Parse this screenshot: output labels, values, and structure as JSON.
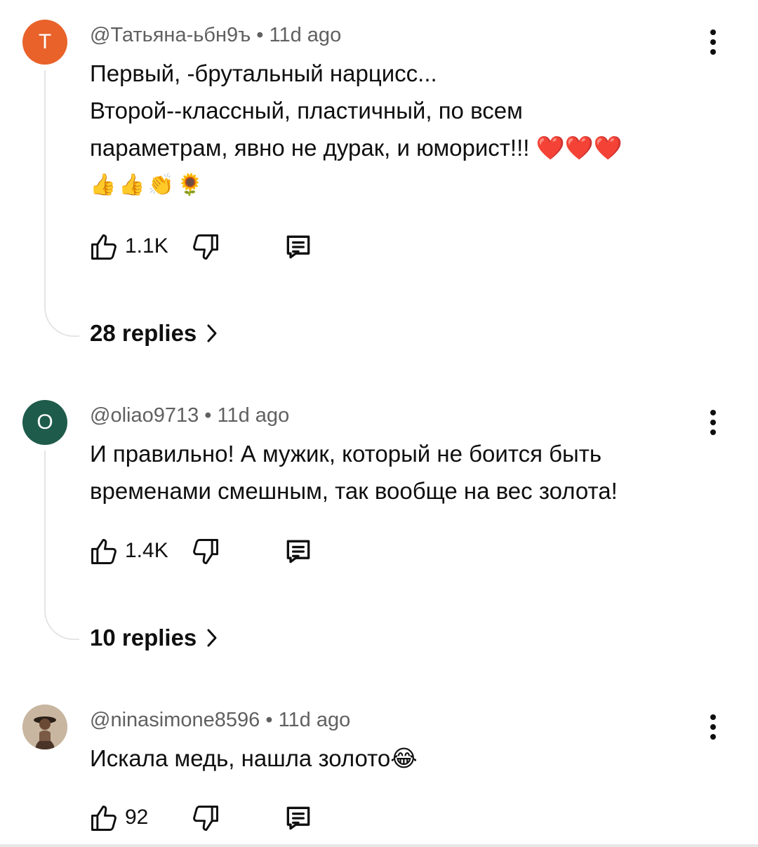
{
  "comments": [
    {
      "avatar_letter": "T",
      "avatar_color": "#e8622a",
      "author": "@Татьяна-ьбн9ъ",
      "time": "11d ago",
      "lines": [
        "Первый, -брутальный нарцисс...",
        "Второй--классный, пластичный, по всем",
        "параметрам, явно не дурак, и юморист!!! ❤️❤️❤️",
        "👍👍👏🌻"
      ],
      "likes": "1.1K",
      "replies": "28 replies"
    },
    {
      "avatar_letter": "O",
      "avatar_color": "#1e5b4b",
      "author": "@oliao9713",
      "time": "11d ago",
      "lines": [
        "И правильно! А мужик, который не боится быть",
        "временами смешным, так вообще на вес золота!"
      ],
      "likes": "1.4K",
      "replies": "10 replies"
    },
    {
      "avatar_letter": "",
      "avatar_color": "#b9a48e",
      "author": "@ninasimone8596",
      "time": "11d ago",
      "lines": [
        "Искала медь, нашла золото😂"
      ],
      "likes": "92"
    }
  ],
  "separator": "•",
  "icons": {
    "like": "thumb-up-icon",
    "dislike": "thumb-down-icon",
    "reply": "comment-icon",
    "more": "more-vert-icon",
    "chevron": "chevron-right-icon"
  }
}
